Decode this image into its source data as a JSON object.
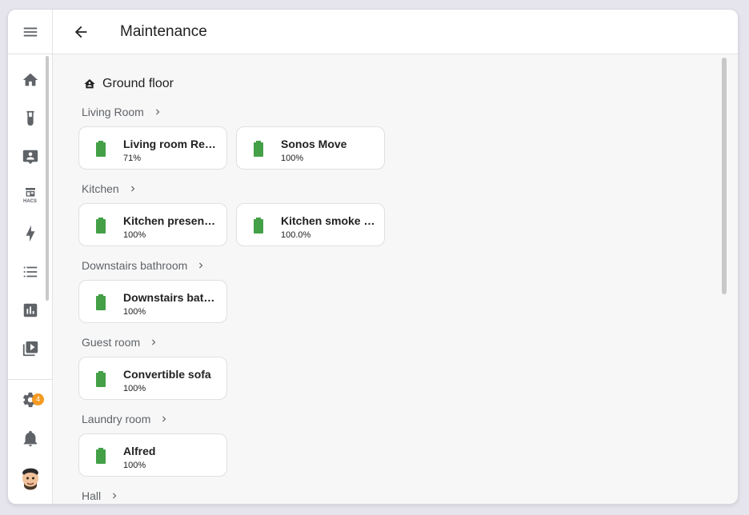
{
  "header": {
    "title": "Maintenance"
  },
  "sidebar": {
    "items": [
      {
        "icon": "home-icon"
      },
      {
        "icon": "flask-icon"
      },
      {
        "icon": "account-box-icon"
      },
      {
        "icon": "hacs-icon",
        "label": "HACS"
      },
      {
        "icon": "lightning-bolt-icon"
      },
      {
        "icon": "format-list-icon"
      },
      {
        "icon": "chart-box-icon"
      },
      {
        "icon": "play-box-icon"
      }
    ],
    "settings_badge": "4"
  },
  "floor": {
    "name": "Ground floor"
  },
  "areas": [
    {
      "name": "Living Room",
      "devices": [
        {
          "name": "Living room Remote",
          "value": "71%"
        },
        {
          "name": "Sonos Move",
          "value": "100%"
        }
      ]
    },
    {
      "name": "Kitchen",
      "devices": [
        {
          "name": "Kitchen presence sensor",
          "value": "100%"
        },
        {
          "name": "Kitchen smoke detector",
          "value": "100.0%"
        }
      ]
    },
    {
      "name": "Downstairs bathroom",
      "devices": [
        {
          "name": "Downstairs bathroom sensor",
          "value": "100%"
        }
      ]
    },
    {
      "name": "Guest room",
      "devices": [
        {
          "name": "Convertible sofa",
          "value": "100%"
        }
      ]
    },
    {
      "name": "Laundry room",
      "devices": [
        {
          "name": "Alfred",
          "value": "100%"
        }
      ]
    },
    {
      "name": "Hall",
      "devices": []
    }
  ],
  "colors": {
    "battery": "#43a047",
    "badge": "#f49a22"
  }
}
